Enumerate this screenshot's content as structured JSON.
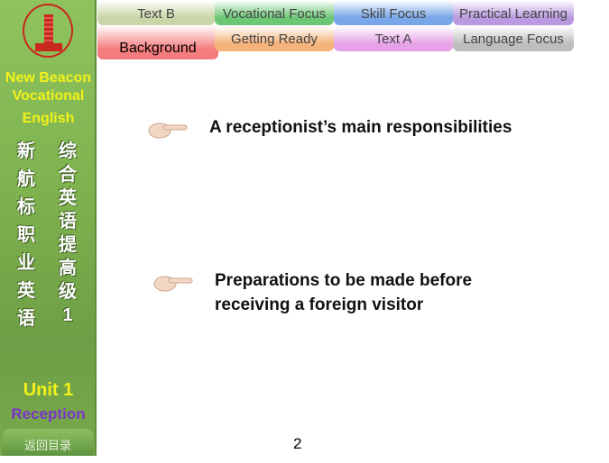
{
  "sidebar": {
    "brand": [
      "New Beacon",
      "Vocational",
      "English"
    ],
    "title_left": [
      "新",
      "航",
      "标",
      "职",
      "业",
      "英",
      "语"
    ],
    "title_right": [
      "综",
      "合",
      "英",
      "语",
      "提",
      "高",
      "级",
      "1"
    ],
    "unit": "Unit 1",
    "unit_name": "Reception",
    "back_label": "返回目录"
  },
  "tabs": [
    {
      "label": "Text B",
      "color": "#c9d6a8"
    },
    {
      "label": "Vocational Focus",
      "color": "#6cc775"
    },
    {
      "label": "Skill Focus",
      "color": "#78a6e8"
    },
    {
      "label": "Practical Learning",
      "color": "#b99ae0"
    },
    {
      "label": "Background",
      "color": "#f47c7c",
      "active": true
    },
    {
      "label": "Getting Ready",
      "color": "#f5b27a"
    },
    {
      "label": "Text A",
      "color": "#e6a2e6"
    },
    {
      "label": "Language Focus",
      "color": "#bdbdbd"
    }
  ],
  "points": [
    "A receptionist’s main responsibilities",
    "Preparations to be made before receiving a foreign visitor"
  ],
  "page_number": "2"
}
